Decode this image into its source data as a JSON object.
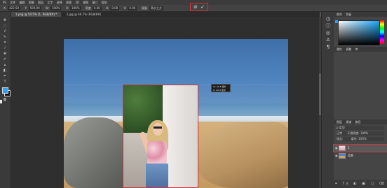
{
  "menubar": {
    "items": [
      "PS",
      "文件",
      "编辑",
      "图像",
      "图层",
      "文字",
      "选择",
      "滤镜",
      "3D",
      "视图",
      "窗口",
      "帮助"
    ]
  },
  "options_bar": {
    "items": [
      {
        "label": "X:",
        "value": "422.50"
      },
      {
        "label": "Y:",
        "value": "500.00"
      },
      {
        "label": "W:",
        "value": "100%"
      },
      {
        "label": "H:",
        "value": "100%"
      },
      {
        "label": "角度",
        "value": "0.00"
      },
      {
        "label": "H:",
        "value": "0.00"
      },
      {
        "label": "V:",
        "value": "0.00"
      },
      {
        "label": "插值:",
        "value": "两次立方"
      }
    ],
    "cancel_glyph": "⊘",
    "commit_glyph": "✓"
  },
  "tabs": [
    {
      "label": "1.png @ 50.5% (1, RGB/8#) *",
      "active": true
    },
    {
      "label": "2.jpg @ 66.7% (RGB/8#)",
      "active": false
    }
  ],
  "tooltip": {
    "line1": "W: 45.8 厘米",
    "line2": "H: 60.8 厘米"
  },
  "right_panel": {
    "color_tabs": [
      "颜色",
      "色板"
    ],
    "section_tabs": [
      "属性",
      "调整",
      "库"
    ],
    "layers_tabs": [
      "图层",
      "通道",
      "路径"
    ],
    "kind_filter": "ρ 类型",
    "blend_mode": "正常",
    "opacity_label": "不透明度:",
    "opacity": "100%",
    "lock_label": "锁定:",
    "fill_label": "填充:",
    "fill": "100%",
    "layers": [
      {
        "name": "1",
        "selected": true
      },
      {
        "name": "背景",
        "selected": false
      }
    ],
    "footer_icons": "⚭ fx ◐ ▣ ▢ ⌫"
  },
  "colors": {
    "accent_red": "#d0343b",
    "foreground": "#2aa0ff",
    "background": "#111111"
  }
}
